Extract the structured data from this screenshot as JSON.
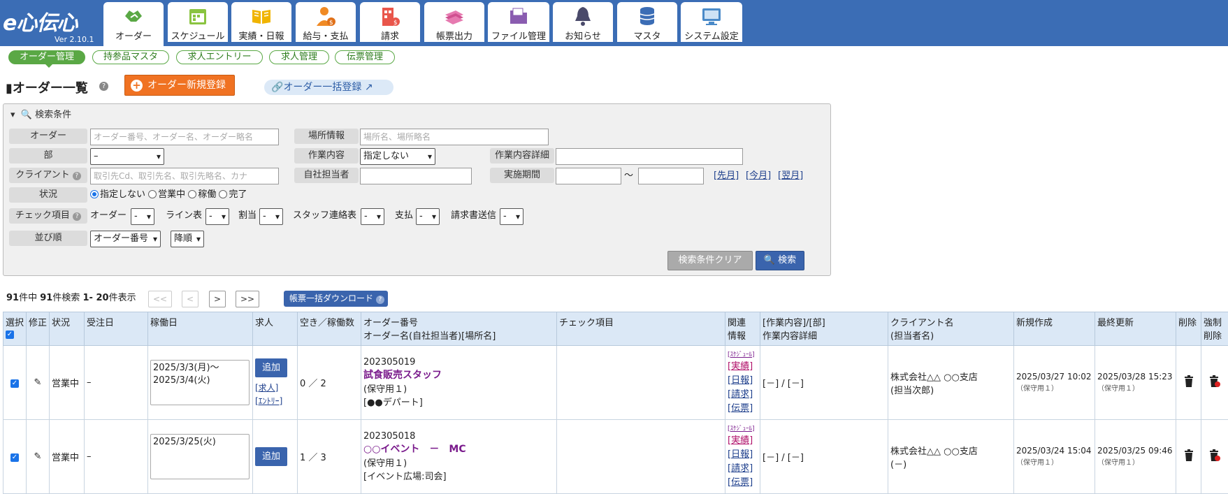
{
  "app": {
    "logo": "e心伝心",
    "version": "Ver 2.10.1"
  },
  "nav": [
    {
      "label": "オーダー",
      "icon": "handshake-icon"
    },
    {
      "label": "スケジュール",
      "icon": "calendar-icon"
    },
    {
      "label": "実績・日報",
      "icon": "book-icon"
    },
    {
      "label": "給与・支払",
      "icon": "person-money-icon"
    },
    {
      "label": "請求",
      "icon": "building-money-icon"
    },
    {
      "label": "帳票出力",
      "icon": "documents-icon"
    },
    {
      "label": "ファイル管理",
      "icon": "folder-icon"
    },
    {
      "label": "お知らせ",
      "icon": "bell-icon"
    },
    {
      "label": "マスタ",
      "icon": "database-icon"
    },
    {
      "label": "システム設定",
      "icon": "settings-screen-icon"
    }
  ],
  "subnav": [
    "オーダー管理",
    "持参品マスタ",
    "求人エントリー",
    "求人管理",
    "伝票管理"
  ],
  "page": {
    "title": "オーダー一覧",
    "new_button": "オーダー新規登録",
    "bulk_register": "オーダー一括登録"
  },
  "search": {
    "header": "検索条件",
    "order_label": "オーダー",
    "order_placeholder": "オーダー番号、オーダー名、オーダー略名",
    "dept_label": "部",
    "dept_value": "–",
    "client_label": "クライアント",
    "client_placeholder": "取引先Cd、取引先名、取引先略名、カナ",
    "status_label": "状況",
    "status_options": [
      "指定しない",
      "営業中",
      "稼働",
      "完了"
    ],
    "check_label": "チェック項目",
    "check_items": [
      "オーダー",
      "ライン表",
      "割当",
      "スタッフ連絡表",
      "支払",
      "請求書送信"
    ],
    "check_value": "-",
    "sort_label": "並び順",
    "sort_value": "オーダー番号",
    "sort_dir": "降順",
    "place_label": "場所情報",
    "place_placeholder": "場所名、場所略名",
    "work_label": "作業内容",
    "work_value": "指定しない",
    "work_detail_label": "作業内容詳細",
    "staff_label": "自社担当者",
    "period_label": "実施期間",
    "period_sep": "～",
    "prev_month": "[先月]",
    "this_month": "[今月]",
    "next_month": "[翌月]",
    "clear_button": "検索条件クリア",
    "search_button": "検索"
  },
  "pager": {
    "total": "91",
    "total_suffix": "件中",
    "found": "91",
    "found_suffix": "件検索",
    "range": "1- 20",
    "range_suffix": "件表示",
    "first": "<<",
    "prev": "<",
    "next": ">",
    "last": ">>",
    "download": "帳票一括ダウンロード"
  },
  "table": {
    "headers": {
      "select": "選択",
      "edit": "修正",
      "status": "状況",
      "received": "受注日",
      "workdate": "稼働日",
      "recruit": "求人",
      "vacancy": "空き／稼働数",
      "order_no": "オーダー番号",
      "order_name": "オーダー名(自社担当者)[場所名]",
      "check": "チェック項目",
      "related1": "関連",
      "related2": "情報",
      "work1": "[作業内容]/[部]",
      "work2": "作業内容詳細",
      "client1": "クライアント名",
      "client2": "(担当者名)",
      "created": "新規作成",
      "updated": "最終更新",
      "delete": "削除",
      "force1": "強制",
      "force2": "削除"
    },
    "rows": [
      {
        "status": "営業中",
        "received": "–",
        "workdate_line1": "2025/3/3(月)～",
        "workdate_line2": "2025/3/4(火)",
        "add": "追加",
        "recruit_link": "[求人]",
        "entry_link": "[ｴﾝﾄﾘｰ]",
        "vacancy": "0 ／ 2",
        "order_no": "202305019",
        "order_name": "試食販売スタッフ",
        "staff": "(保守用１)",
        "place": "[●●デパート]",
        "rel": [
          "[ｽｹｼﾞｭｰﾙ]",
          "[実績]",
          "[日報]",
          "[請求]",
          "[伝票]"
        ],
        "work": "[－] / [－]",
        "client": "株式会社△△ ○○支店",
        "client_person": "(担当次郎)",
        "created": "2025/03/27 10:02",
        "created_by": "（保守用１）",
        "updated": "2025/03/28 15:23",
        "updated_by": "（保守用１）"
      },
      {
        "status": "営業中",
        "received": "–",
        "workdate_line1": "2025/3/25(火)",
        "workdate_line2": "",
        "add": "追加",
        "recruit_link": "",
        "entry_link": "",
        "vacancy": "1 ／ 3",
        "order_no": "202305018",
        "order_name": "○○イベント　－　MC",
        "staff": "(保守用１)",
        "place": "[イベント広場:司会]",
        "rel": [
          "[ｽｹｼﾞｭｰﾙ]",
          "[実績]",
          "[日報]",
          "[請求]",
          "[伝票]"
        ],
        "work": "[－] / [－]",
        "client": "株式会社△△ ○○支店",
        "client_person": "(－)",
        "created": "2025/03/24 15:04",
        "created_by": "（保守用１）",
        "updated": "2025/03/25 09:46",
        "updated_by": "（保守用１）"
      }
    ]
  },
  "colors": {
    "nav_bg": "#3b6db5",
    "accent_green": "#5aa845",
    "button_blue": "#3a64ad",
    "button_orange": "#f07222",
    "header_blue": "#dbe8f6"
  }
}
